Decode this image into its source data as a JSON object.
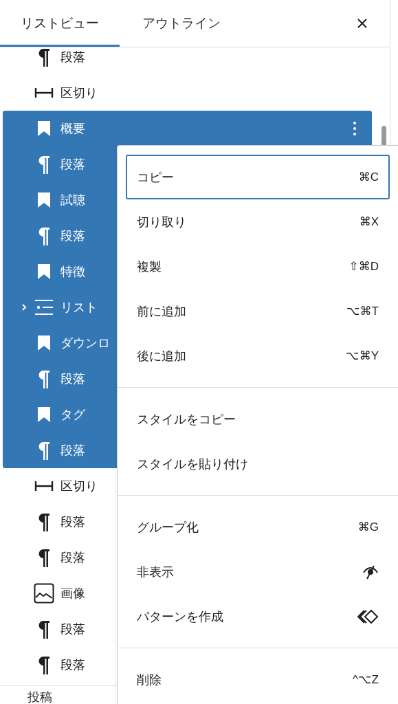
{
  "tabs": [
    {
      "label": "リストビュー",
      "selected": true
    },
    {
      "label": "アウトライン",
      "selected": false
    }
  ],
  "blocks": [
    {
      "kind": "paragraph",
      "label": "段落",
      "selected": false,
      "menu_open": false
    },
    {
      "kind": "separator",
      "label": "区切り",
      "selected": false,
      "menu_open": false
    },
    {
      "kind": "bookmark",
      "label": "概要",
      "selected": true,
      "menu_open": true
    },
    {
      "kind": "paragraph",
      "label": "段落",
      "selected": true,
      "menu_open": false
    },
    {
      "kind": "bookmark",
      "label": "試聴",
      "selected": true,
      "menu_open": false
    },
    {
      "kind": "paragraph",
      "label": "段落",
      "selected": true,
      "menu_open": false
    },
    {
      "kind": "bookmark",
      "label": "特徴",
      "selected": true,
      "menu_open": false
    },
    {
      "kind": "list",
      "label": "リスト",
      "selected": true,
      "menu_open": false,
      "expanded": false
    },
    {
      "kind": "bookmark",
      "label": "ダウンロ",
      "selected": true,
      "menu_open": false
    },
    {
      "kind": "paragraph",
      "label": "段落",
      "selected": true,
      "menu_open": false
    },
    {
      "kind": "bookmark",
      "label": "タグ",
      "selected": true,
      "menu_open": false
    },
    {
      "kind": "paragraph",
      "label": "段落",
      "selected": true,
      "menu_open": false
    },
    {
      "kind": "separator",
      "label": "区切り",
      "selected": false,
      "menu_open": false
    },
    {
      "kind": "paragraph",
      "label": "段落",
      "selected": false,
      "menu_open": false
    },
    {
      "kind": "paragraph",
      "label": "段落",
      "selected": false,
      "menu_open": false
    },
    {
      "kind": "image",
      "label": "画像",
      "selected": false,
      "menu_open": false
    },
    {
      "kind": "paragraph",
      "label": "段落",
      "selected": false,
      "menu_open": false
    },
    {
      "kind": "paragraph",
      "label": "段落",
      "selected": false,
      "menu_open": false
    }
  ],
  "footer": {
    "label": "投稿"
  },
  "menu": {
    "groups": [
      {
        "items": [
          {
            "label": "コピー",
            "shortcut": "⌘C",
            "focused": true
          },
          {
            "label": "切り取り",
            "shortcut": "⌘X",
            "focused": false
          },
          {
            "label": "複製",
            "shortcut": "⇧⌘D",
            "focused": false
          },
          {
            "label": "前に追加",
            "shortcut": "⌥⌘T",
            "focused": false
          },
          {
            "label": "後に追加",
            "shortcut": "⌥⌘Y",
            "focused": false
          }
        ]
      },
      {
        "items": [
          {
            "label": "スタイルをコピー",
            "focused": false
          },
          {
            "label": "スタイルを貼り付け",
            "focused": false
          }
        ]
      },
      {
        "items": [
          {
            "label": "グループ化",
            "shortcut": "⌘G",
            "focused": false
          },
          {
            "label": "非表示",
            "kind": "visibility",
            "focused": false
          },
          {
            "label": "パターンを作成",
            "kind": "pattern",
            "focused": false
          }
        ]
      },
      {
        "items": [
          {
            "label": "削除",
            "shortcut": "^⌥Z",
            "focused": false
          }
        ]
      }
    ]
  }
}
